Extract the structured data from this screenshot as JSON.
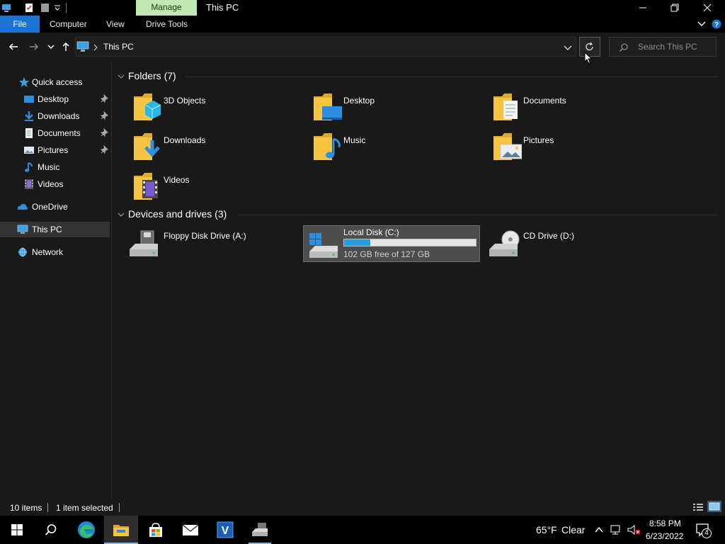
{
  "window": {
    "title": "This PC",
    "contextual_tab": "Manage"
  },
  "ribbon": {
    "file_label": "File",
    "tabs": [
      {
        "label": "Computer"
      },
      {
        "label": "View"
      },
      {
        "label": "Drive Tools"
      }
    ]
  },
  "address": {
    "path": "This PC"
  },
  "search": {
    "placeholder": "Search This PC"
  },
  "nav": {
    "quick_access": "Quick access",
    "items": [
      {
        "label": "Desktop",
        "pinned": true
      },
      {
        "label": "Downloads",
        "pinned": true
      },
      {
        "label": "Documents",
        "pinned": true
      },
      {
        "label": "Pictures",
        "pinned": true
      },
      {
        "label": "Music",
        "pinned": false
      },
      {
        "label": "Videos",
        "pinned": false
      }
    ],
    "onedrive": "OneDrive",
    "thispc": "This PC",
    "network": "Network"
  },
  "folders": {
    "header": "Folders (7)",
    "items": [
      {
        "label": "3D Objects",
        "icon": "3d-objects-folder-icon"
      },
      {
        "label": "Desktop",
        "icon": "desktop-folder-icon"
      },
      {
        "label": "Documents",
        "icon": "documents-folder-icon"
      },
      {
        "label": "Downloads",
        "icon": "downloads-folder-icon"
      },
      {
        "label": "Music",
        "icon": "music-folder-icon"
      },
      {
        "label": "Pictures",
        "icon": "pictures-folder-icon"
      },
      {
        "label": "Videos",
        "icon": "videos-folder-icon"
      }
    ]
  },
  "drives": {
    "header": "Devices and drives (3)",
    "items": [
      {
        "label": "Floppy Disk Drive (A:)",
        "icon": "floppy-drive-icon"
      },
      {
        "label": "Local Disk (C:)",
        "icon": "local-disk-icon",
        "free_text": "102 GB free of 127 GB",
        "used_fraction": 0.197,
        "selected": true
      },
      {
        "label": "CD Drive (D:)",
        "icon": "cd-drive-icon"
      }
    ]
  },
  "status": {
    "items_count": "10 items",
    "selected": "1 item selected"
  },
  "taskbar": {
    "weather_temp": "65°F",
    "weather_desc": "Clear",
    "time": "8:58 PM",
    "date": "6/23/2022",
    "notification_count": "4"
  },
  "colors": {
    "accent": "#1a73d1",
    "manage_tab": "#c2e7b1",
    "usage_fill": "#26a0da",
    "folder_yellow": "#f5c542"
  }
}
